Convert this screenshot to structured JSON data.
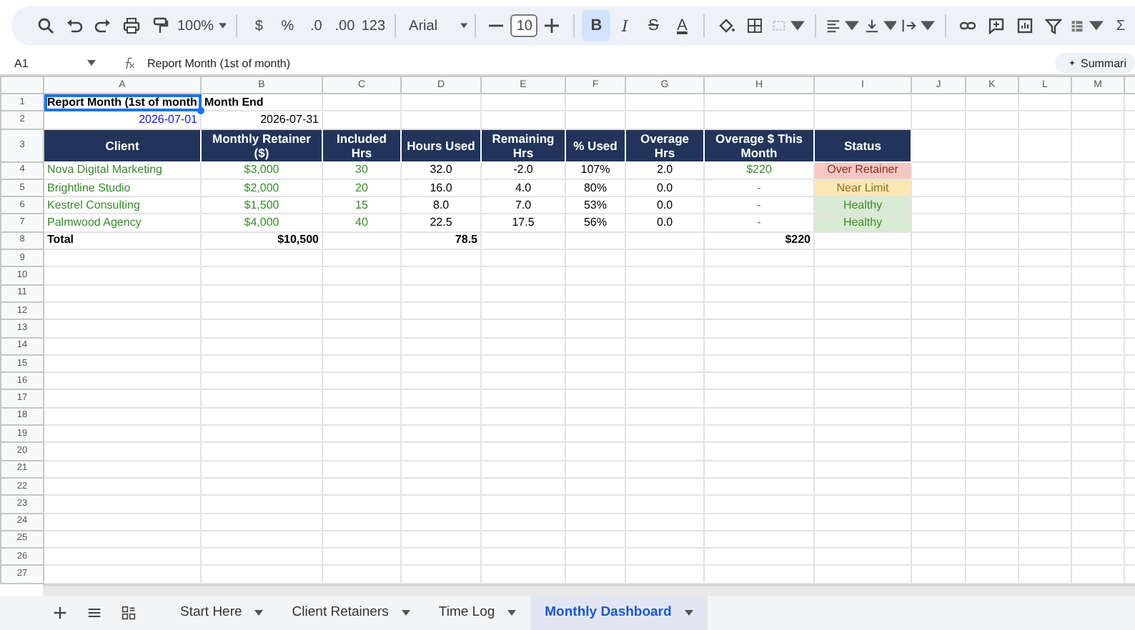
{
  "toolbar": {
    "zoom": "100%",
    "currency": "$",
    "percent": "%",
    "decimal_decrease": ".0",
    "decimal_increase": ".00",
    "number_format": "123",
    "font": "Arial",
    "font_size": "10",
    "format_buttons": [
      {
        "label": "B",
        "kind": "bold",
        "on": true
      },
      {
        "label": "I",
        "kind": "italic",
        "on": false
      },
      {
        "label": "S",
        "kind": "strike",
        "on": false
      },
      {
        "label": "A",
        "kind": "color",
        "on": false
      }
    ],
    "sum": "Σ"
  },
  "formula_bar": {
    "cell_ref": "A1",
    "formula": "Report Month (1st of month)",
    "summarize": "Summari"
  },
  "columns": [
    "A",
    "B",
    "C",
    "D",
    "E",
    "F",
    "G",
    "H",
    "I",
    "J",
    "K",
    "L",
    "M"
  ],
  "rows": [
    {
      "number": "1",
      "cells": [
        {
          "text": "Report Month (1st of month",
          "kind": "label",
          "selected": true
        },
        {
          "text": "Month End",
          "kind": "label",
          "selected": false
        }
      ]
    },
    {
      "number": "2",
      "cells": [
        {
          "text": "2026-07-01",
          "kind": "date_input",
          "selected": false
        },
        {
          "text": "2026-07-31",
          "kind": "date",
          "selected": false
        }
      ]
    },
    {
      "number": "3",
      "kind": "tall",
      "cells": [
        {
          "text": "Client",
          "kind": "header",
          "selected": false
        },
        {
          "text": "Monthly Retainer ($)",
          "kind": "header",
          "selected": false
        },
        {
          "text": "Included Hrs",
          "kind": "header",
          "selected": false
        },
        {
          "text": "Hours Used",
          "kind": "header",
          "selected": false
        },
        {
          "text": "Remaining Hrs",
          "kind": "header",
          "selected": false
        },
        {
          "text": "% Used",
          "kind": "header",
          "selected": false
        },
        {
          "text": "Overage Hrs",
          "kind": "header",
          "selected": false
        },
        {
          "text": "Overage $ This Month",
          "kind": "header",
          "selected": false
        },
        {
          "text": "Status",
          "kind": "header",
          "selected": false
        }
      ]
    },
    {
      "number": "4",
      "cells": [
        {
          "text": "Nova Digital Marketing",
          "kind": "name",
          "selected": false
        },
        {
          "text": "$3,000",
          "kind": "input",
          "selected": false
        },
        {
          "text": "30",
          "kind": "input",
          "selected": false
        },
        {
          "text": "32.0",
          "kind": "value",
          "selected": false
        },
        {
          "text": "-2.0",
          "kind": "value",
          "selected": false
        },
        {
          "text": "107%",
          "kind": "value",
          "selected": false
        },
        {
          "text": "2.0",
          "kind": "value",
          "selected": false
        },
        {
          "text": "$220",
          "kind": "input",
          "selected": false
        },
        {
          "text": "Over Retainer",
          "kind": "status",
          "color": "#f4c7c3",
          "selected": false
        }
      ]
    },
    {
      "number": "5",
      "cells": [
        {
          "text": "Brightline Studio",
          "kind": "name",
          "selected": false
        },
        {
          "text": "$2,000",
          "kind": "input",
          "selected": false
        },
        {
          "text": "20",
          "kind": "input",
          "selected": false
        },
        {
          "text": "16.0",
          "kind": "value",
          "selected": false
        },
        {
          "text": "4.0",
          "kind": "value",
          "selected": false
        },
        {
          "text": "80%",
          "kind": "value",
          "selected": false
        },
        {
          "text": "0.0",
          "kind": "value",
          "selected": false
        },
        {
          "text": "-",
          "kind": "input",
          "selected": false
        },
        {
          "text": "Near Limit",
          "kind": "status",
          "color": "#fce8b2",
          "selected": false
        }
      ]
    },
    {
      "number": "6",
      "cells": [
        {
          "text": "Kestrel Consulting",
          "kind": "name",
          "selected": false
        },
        {
          "text": "$1,500",
          "kind": "input",
          "selected": false
        },
        {
          "text": "15",
          "kind": "input",
          "selected": false
        },
        {
          "text": "8.0",
          "kind": "value",
          "selected": false
        },
        {
          "text": "7.0",
          "kind": "value",
          "selected": false
        },
        {
          "text": "53%",
          "kind": "value",
          "selected": false
        },
        {
          "text": "0.0",
          "kind": "value",
          "selected": false
        },
        {
          "text": "-",
          "kind": "input",
          "selected": false
        },
        {
          "text": "Healthy",
          "kind": "status",
          "color": "#d9ead3",
          "selected": false
        }
      ]
    },
    {
      "number": "7",
      "cells": [
        {
          "text": "Palmwood Agency",
          "kind": "name",
          "selected": false
        },
        {
          "text": "$4,000",
          "kind": "input",
          "selected": false
        },
        {
          "text": "40",
          "kind": "input",
          "selected": false
        },
        {
          "text": "22.5",
          "kind": "value",
          "selected": false
        },
        {
          "text": "17.5",
          "kind": "value",
          "selected": false
        },
        {
          "text": "56%",
          "kind": "value",
          "selected": false
        },
        {
          "text": "0.0",
          "kind": "value",
          "selected": false
        },
        {
          "text": "-",
          "kind": "input",
          "selected": false
        },
        {
          "text": "Healthy",
          "kind": "status",
          "color": "#d9ead3",
          "selected": false
        }
      ]
    },
    {
      "number": "8",
      "cells": [
        {
          "text": "Total",
          "kind": "total_label",
          "selected": false
        },
        {
          "text": "$10,500",
          "kind": "total",
          "selected": false
        },
        null,
        {
          "text": "78.5",
          "kind": "total",
          "selected": false
        },
        null,
        null,
        null,
        {
          "text": "$220",
          "kind": "total",
          "selected": false
        },
        null
      ]
    },
    {
      "number": "9"
    },
    {
      "number": "10"
    },
    {
      "number": "11"
    },
    {
      "number": "12"
    },
    {
      "number": "13"
    },
    {
      "number": "14"
    },
    {
      "number": "15"
    },
    {
      "number": "16"
    },
    {
      "number": "17"
    },
    {
      "number": "18"
    },
    {
      "number": "19"
    },
    {
      "number": "20"
    },
    {
      "number": "21"
    },
    {
      "number": "22"
    },
    {
      "number": "23"
    },
    {
      "number": "24"
    },
    {
      "number": "25"
    },
    {
      "number": "26"
    },
    {
      "number": "27"
    }
  ],
  "sheets": [
    {
      "label": "Start Here",
      "selected": false
    },
    {
      "label": "Client Retainers",
      "selected": false
    },
    {
      "label": "Time Log",
      "selected": false
    },
    {
      "label": "Monthly Dashboard",
      "selected": true
    }
  ]
}
